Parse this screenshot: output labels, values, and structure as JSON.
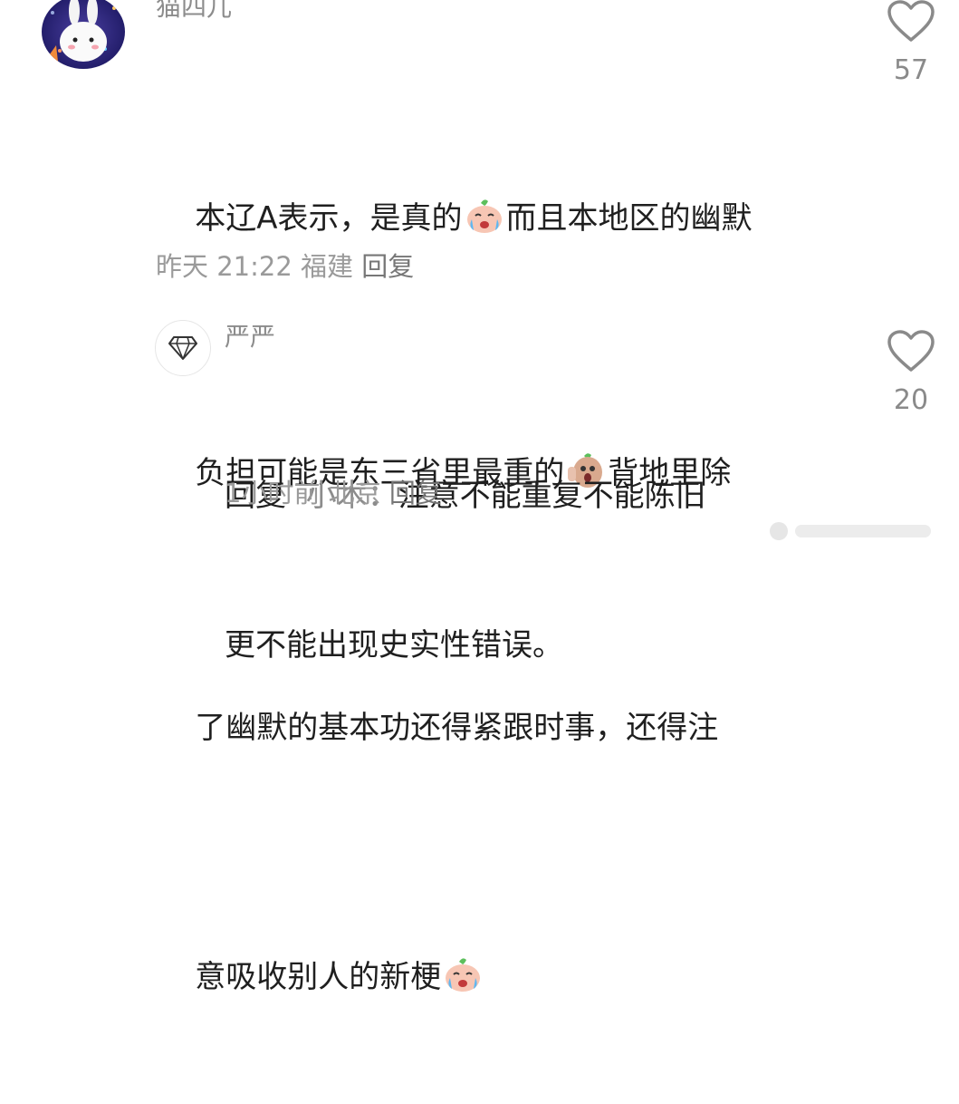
{
  "comment1": {
    "username": "猫四儿",
    "lines": [
      [
        "本辽A表示，是真的",
        "而且本地区的幽默"
      ],
      [
        "负担可能是东三省里最重的",
        "背地里除"
      ],
      [
        "了幽默的基本功还得紧跟时事，还得注"
      ],
      [
        "意吸收别人的新梗",
        ""
      ]
    ],
    "time": "昨天 21:22",
    "location": "福建",
    "reply_label": "回复",
    "like_count": "57"
  },
  "comment2": {
    "username": "严严",
    "reply_prefix": "回复",
    "mention": "小木：",
    "line1_rest": "注意不能重复不能陈旧",
    "line2": "更不能出现史实性错误。",
    "time": "1小时前",
    "location": "北京",
    "reply_label": "回复",
    "like_count": "20"
  },
  "colors": {
    "text": "#1f1f1f",
    "meta": "#9a9a9a",
    "icon": "#8a8a8a"
  }
}
